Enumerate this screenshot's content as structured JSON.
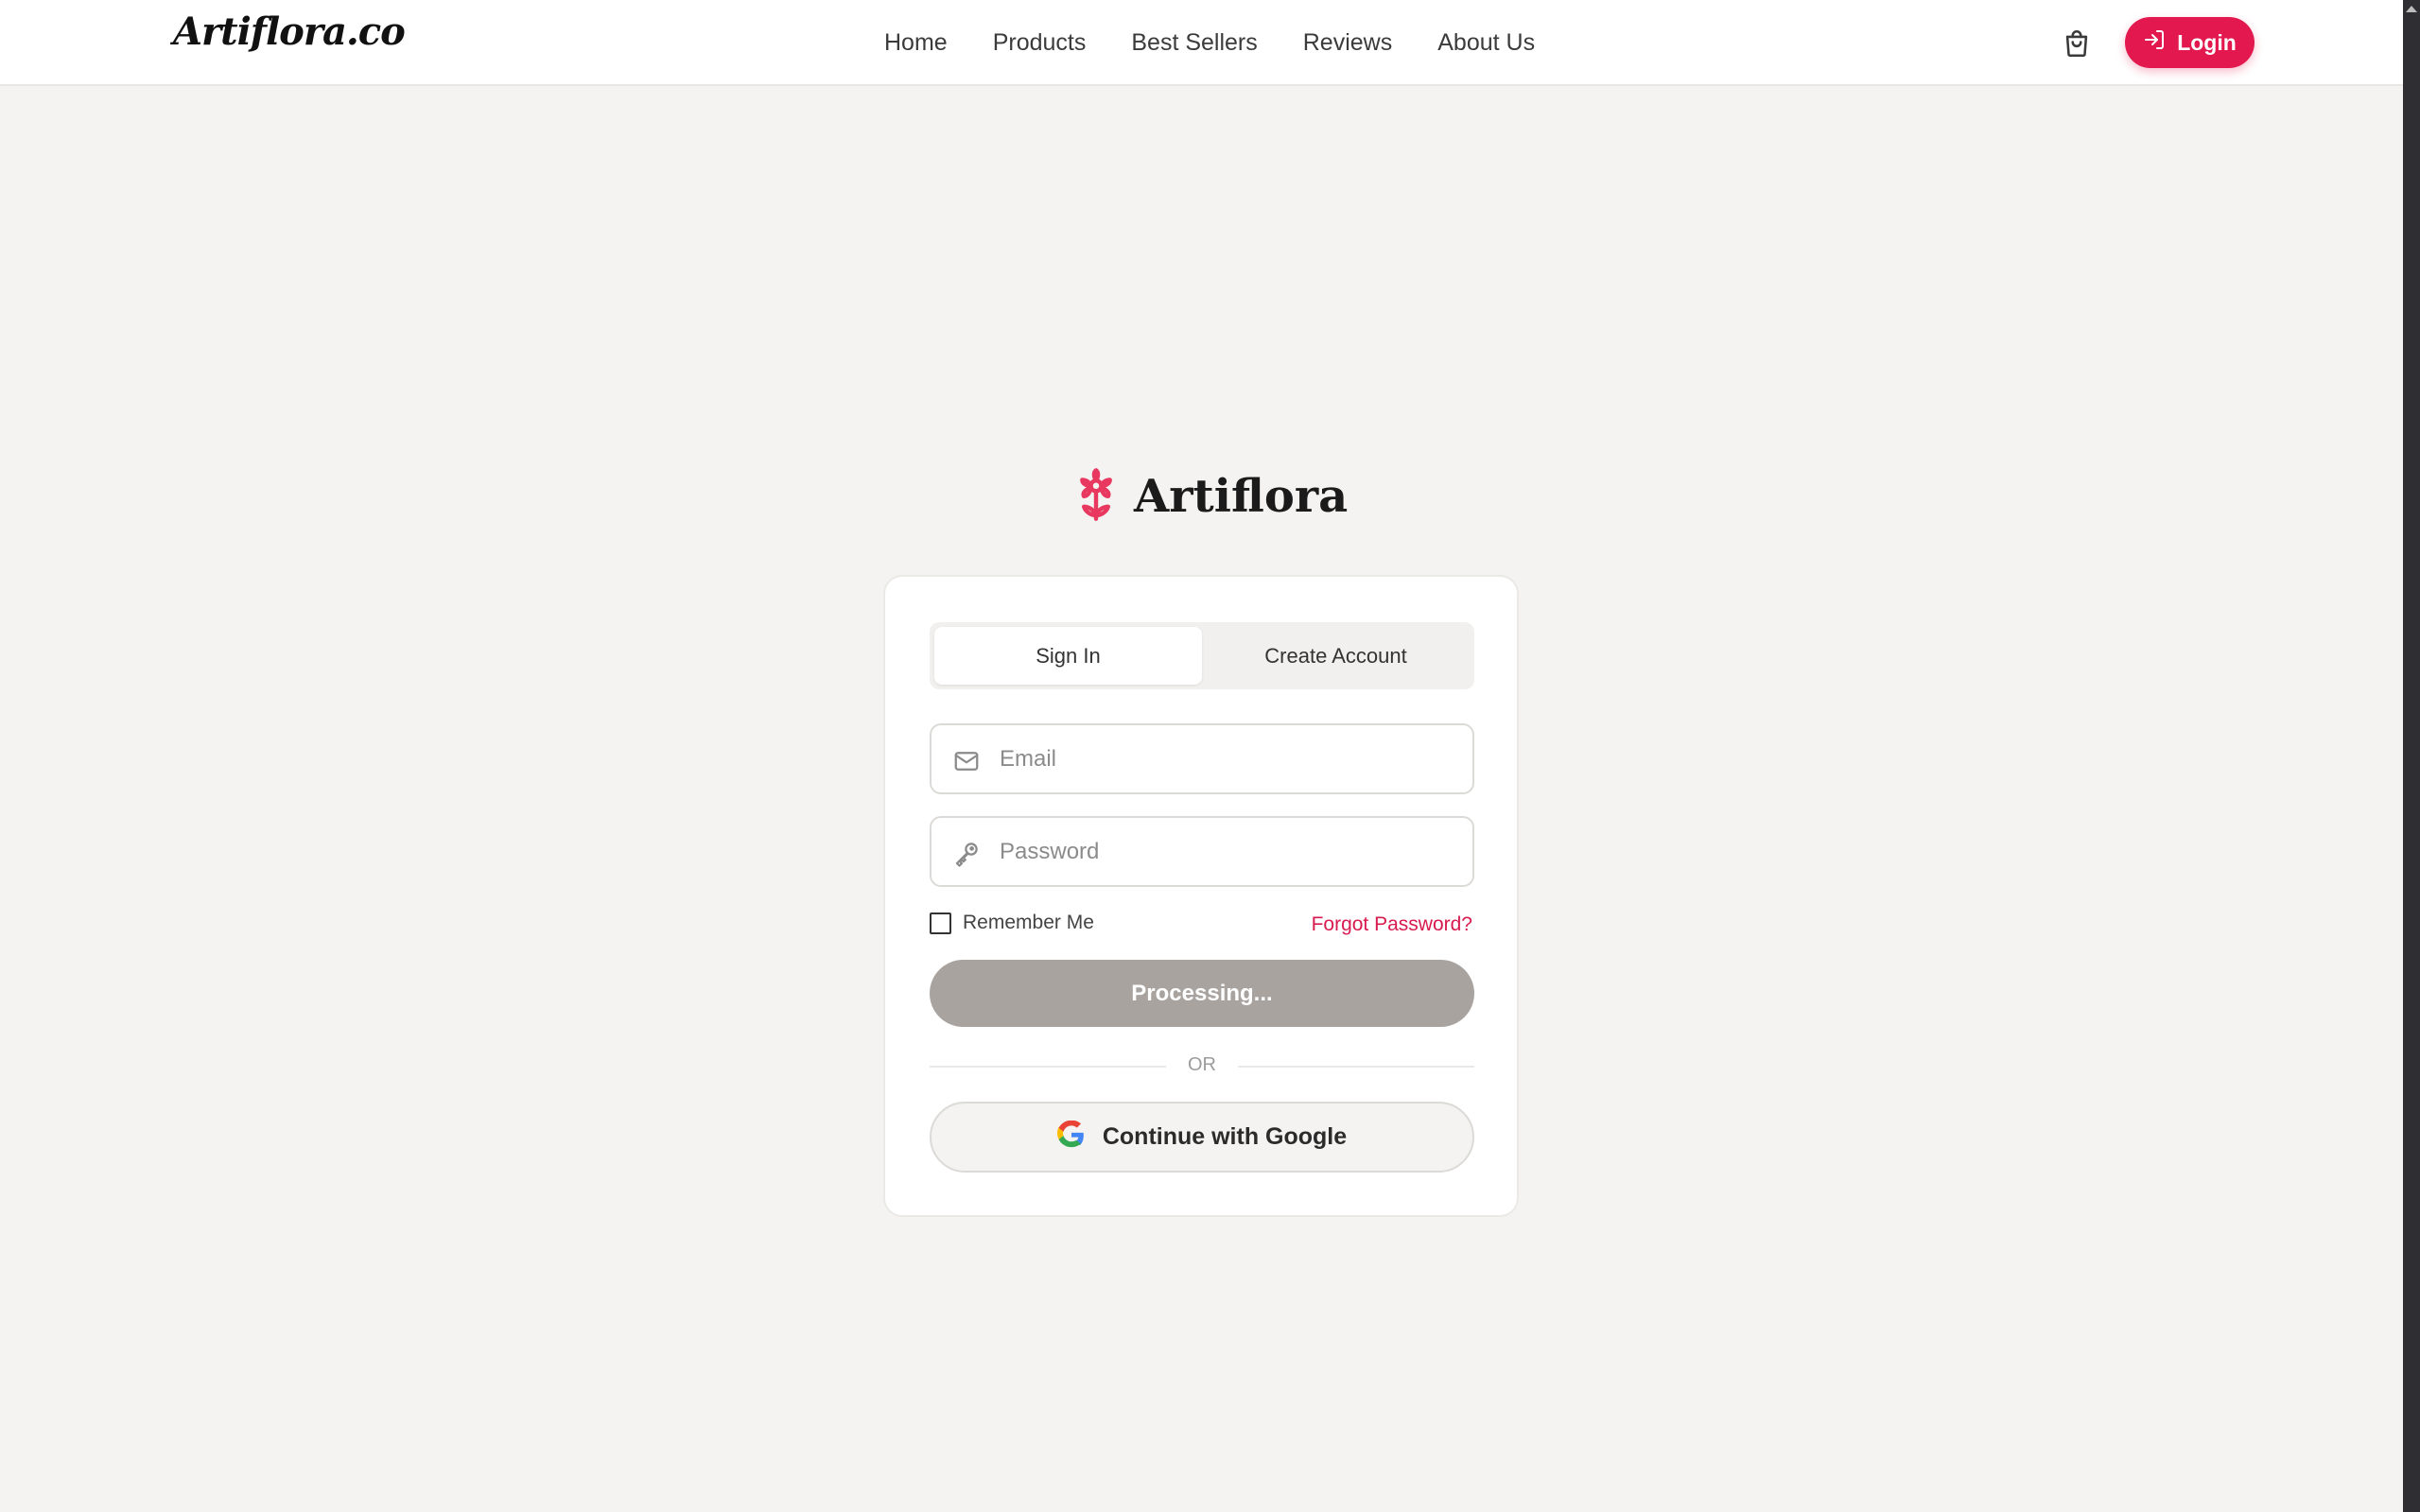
{
  "header": {
    "brand": "Artiflora.co",
    "nav": [
      "Home",
      "Products",
      "Best Sellers",
      "Reviews",
      "About Us"
    ],
    "cart_icon": "shopping-bag-icon",
    "login_label": "Login",
    "login_icon": "log-in-icon"
  },
  "logo": {
    "icon": "flower-icon",
    "text": "Artiflora"
  },
  "auth": {
    "tabs": [
      "Sign In",
      "Create Account"
    ],
    "active_tab": "Sign In",
    "email_placeholder": "Email",
    "email_value": "",
    "email_icon": "mail-icon",
    "password_placeholder": "Password",
    "password_value": "",
    "password_icon": "key-icon",
    "remember_label": "Remember Me",
    "remember_checked": false,
    "forgot_label": "Forgot Password?",
    "submit_label": "Processing...",
    "or_label": "OR",
    "google_label": "Continue with Google",
    "google_icon": "google-icon"
  },
  "colors": {
    "accent": "#e2184f",
    "link": "#d81b4f",
    "background": "#f4f3f1",
    "button_disabled": "#a9a39f"
  }
}
